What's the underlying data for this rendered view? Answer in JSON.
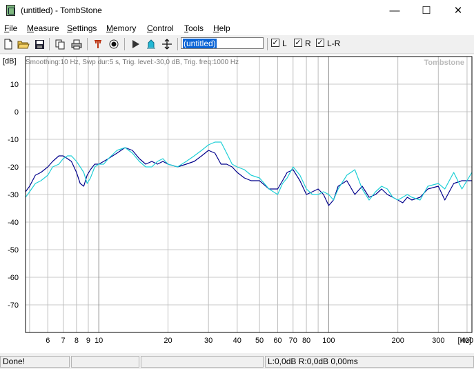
{
  "window": {
    "title": "(untitled) - TombStone",
    "minimize": "—",
    "maximize": "☐",
    "close": "✕"
  },
  "menu": [
    {
      "label": "File",
      "underline": "F"
    },
    {
      "label": "Measure",
      "underline": "M"
    },
    {
      "label": "Settings",
      "underline": "S"
    },
    {
      "label": "Memory",
      "underline": "M"
    },
    {
      "label": "Control",
      "underline": "C"
    },
    {
      "label": "Tools",
      "underline": "T"
    },
    {
      "label": "Help",
      "underline": "H"
    }
  ],
  "toolbar": {
    "file_name": "(untitled)",
    "checkboxes": [
      {
        "label": "L",
        "checked": true
      },
      {
        "label": "R",
        "checked": true
      },
      {
        "label": "L-R",
        "checked": true
      }
    ]
  },
  "chart_data": {
    "type": "line",
    "info": "Smoothing:10 Hz, Swp dur:5 s, Trig. level:-30,0 dB, Trig. freq:1000 Hz",
    "watermark": "Tombstone",
    "ylabel": "[dB]",
    "xlabel_unit": "[Hz]",
    "x_scale": "log",
    "xlim": [
      4.8,
      420
    ],
    "ylim": [
      -80,
      20
    ],
    "yticks": [
      10,
      0,
      -10,
      -20,
      -30,
      -40,
      -50,
      -60,
      -70
    ],
    "xticks": [
      6,
      7,
      8,
      9,
      10,
      20,
      30,
      40,
      50,
      60,
      70,
      80,
      100,
      200,
      300,
      400
    ],
    "grid": true,
    "series": [
      {
        "color": "#00008b",
        "x": [
          4.8,
          5,
          5.3,
          5.6,
          6,
          6.3,
          6.7,
          7,
          7.3,
          7.6,
          8,
          8.3,
          8.6,
          8.9,
          9.2,
          9.6,
          10,
          10.5,
          11,
          12,
          13,
          14,
          15,
          16,
          17,
          18,
          19,
          20,
          22,
          24,
          26,
          28,
          30,
          32,
          34,
          36,
          38,
          40,
          43,
          46,
          50,
          55,
          60,
          63,
          66,
          70,
          75,
          80,
          85,
          90,
          95,
          100,
          105,
          110,
          120,
          130,
          140,
          150,
          160,
          170,
          180,
          190,
          200,
          210,
          220,
          230,
          250,
          270,
          300,
          320,
          350,
          380,
          420
        ],
        "y": [
          -29,
          -27,
          -23,
          -22,
          -20,
          -18,
          -16,
          -16,
          -17,
          -18,
          -22,
          -26,
          -27,
          -23,
          -21,
          -19,
          -19,
          -18,
          -17,
          -15,
          -13,
          -14,
          -17,
          -19,
          -18,
          -19,
          -18,
          -19,
          -20,
          -19,
          -18,
          -16,
          -14,
          -15,
          -19,
          -19,
          -20,
          -22,
          -24,
          -25,
          -25,
          -28,
          -28,
          -25,
          -22,
          -21,
          -25,
          -30,
          -29,
          -28,
          -30,
          -34,
          -32,
          -27,
          -25,
          -30,
          -27,
          -31,
          -30,
          -28,
          -30,
          -31,
          -32,
          -33,
          -31,
          -32,
          -31,
          -28,
          -27,
          -32,
          -26,
          -25,
          -25
        ]
      },
      {
        "color": "#1ecfd6",
        "x": [
          4.8,
          5,
          5.3,
          5.6,
          6,
          6.3,
          6.7,
          7,
          7.3,
          7.6,
          8,
          8.3,
          8.6,
          8.9,
          9.2,
          9.6,
          10,
          10.5,
          11,
          12,
          13,
          14,
          15,
          16,
          17,
          18,
          19,
          20,
          22,
          24,
          26,
          28,
          30,
          32,
          34,
          36,
          38,
          40,
          43,
          46,
          50,
          55,
          60,
          63,
          66,
          70,
          75,
          80,
          85,
          90,
          95,
          100,
          105,
          110,
          120,
          130,
          140,
          150,
          160,
          170,
          180,
          190,
          200,
          210,
          220,
          230,
          250,
          270,
          300,
          320,
          350,
          380,
          420
        ],
        "y": [
          -31,
          -29,
          -26,
          -25,
          -23,
          -20,
          -19,
          -17,
          -16,
          -16,
          -18,
          -20,
          -22,
          -26,
          -24,
          -20,
          -19,
          -19,
          -17,
          -14,
          -13,
          -15,
          -18,
          -20,
          -20,
          -18,
          -17,
          -19,
          -20,
          -18,
          -16,
          -14,
          -12,
          -11,
          -11,
          -15,
          -19,
          -20,
          -21,
          -23,
          -24,
          -28,
          -30,
          -26,
          -24,
          -20,
          -23,
          -28,
          -30,
          -30,
          -29,
          -30,
          -32,
          -28,
          -23,
          -21,
          -28,
          -32,
          -29,
          -27,
          -28,
          -31,
          -32,
          -31,
          -30,
          -31,
          -32,
          -27,
          -26,
          -28,
          -22,
          -28,
          -22
        ]
      }
    ]
  },
  "status": {
    "message": "Done!",
    "levels": "L:0,0dB R:0,0dB 0,00ms"
  }
}
